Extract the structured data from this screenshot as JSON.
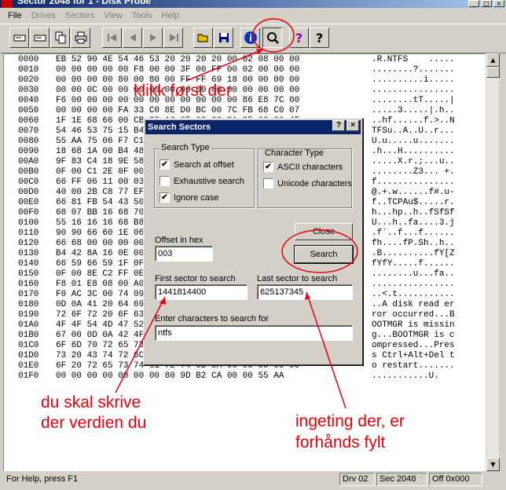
{
  "window": {
    "title": "Sector 2048 for 1 - Disk Probe",
    "minimize": "_",
    "maximize": "□",
    "close": "×"
  },
  "menu": [
    "File",
    "Drives",
    "Sectors",
    "View",
    "Tools",
    "Help"
  ],
  "hex_rows": [
    [
      "0000",
      "EB 52 90 4E 54 46 53 20 20 20 20 00 02 08 00 00",
      ".R.NTFS    ....."
    ],
    [
      "0010",
      "00 00 00 00 00 F8 00 00 3F 00 FF 00 02 00 00 00",
      "........?......."
    ],
    [
      "0020",
      "00 00 00 00 80 00 80 00 FF FF 69 18 00 00 00 00",
      "..........i....."
    ],
    [
      "0030",
      "00 00 0C 00 00 00 00 00 00 00 00 00 00 00 00 00",
      "................"
    ],
    [
      "0040",
      "F6 00 00 00 00 00 00 00 00 00 00 00 86 E8 7C 00",
      "........tT.....|"
    ],
    [
      "0050",
      "00 00 00 00 FA 33 C0 8E D0 BC 00 7C FB 68 C0 07",
      ".....3.....|.h.."
    ],
    [
      "0060",
      "1F 1E 68 66 00 CB 88 16 0E 00 66 81 3E 03 00 4E",
      "..hf......f.>..N"
    ],
    [
      "0070",
      "54 46 53 75 15 B4 41 BB AA 55 CD 13 72 0C 81 FB",
      "TFSu..A..U..r..."
    ],
    [
      "0080",
      "55 AA 75 06 F7 C1 01 00 75 03 E9 DD 00 1E 83 EC",
      "U.u.....u......."
    ],
    [
      "0090",
      "18 68 1A 00 B4 48 8A 16 0E 00 8B F4 16 1F CD 13",
      ".h...H.........."
    ],
    [
      "00A0",
      "9F 83 C4 18 9E 58 1F 72 E1 3B 06 0B 00 75 DB A3",
      ".....X.r.;...u.."
    ],
    [
      "00B0",
      "0F 00 C1 2E 0F 00 04 1E 5A 33 DB B9 00 20 2B C8",
      "........Z3... +."
    ],
    [
      "00C0",
      "66 FF 06 11 00 03 16 0F 00 8E C2 FF 06 16 00 E8",
      "f..............."
    ],
    [
      "00D0",
      "40 00 2B C8 77 EF B8 00 BB CD 1A 66 23 C0 75 2D",
      "@.+.w......f#.u-"
    ],
    [
      "00E0",
      "66 81 FB 54 43 50 41 75 24 81 F9 02 01 72 1E 16",
      "f..TCPAu$.....r."
    ],
    [
      "00F0",
      "68 07 BB 16 68 70 0E 16 68 09 00 66 53 66 53 66",
      "h...hp..h..fSfSf"
    ],
    [
      "0100",
      "55 16 16 16 68 B8 01 66 61 0E 07 CD 1A 33 C0 6A",
      "U...h..fa....3.j"
    ],
    [
      "0110",
      "90 90 66 60 1E 06 66 A1 11 00 66 03 06 1C 00 1E",
      ".f`..f...f......"
    ],
    [
      "0120",
      "66 68 00 00 00 00 66 50 06 53 68 01 00 68 10 00",
      "fh....fP.Sh..h.."
    ],
    [
      "0130",
      "B4 42 8A 16 0E 00 16 1F 8B F4 CD 13 66 59 5B 5A",
      ".B..........fY[Z"
    ],
    [
      "0140",
      "66 59 66 59 1F 0F 82 16 00 66 FF 06 11 00 03 16",
      "fYfY.....f......"
    ],
    [
      "0150",
      "0F 00 8E C2 FF 0E 16 00 75 BC 07 1F 66 61 C3 A0",
      "........u...fa.."
    ],
    [
      "0160",
      "F8 01 E8 08 00 A0 FB 01 E8 02 00 EB FE B4 01 8B",
      "................"
    ],
    [
      "0170",
      "F0 AC 3C 00 74 09 B4 0E BB 07 00 CD 10 EB F2 C3",
      "..<.t..........."
    ],
    [
      "0180",
      "0D 0A 41 20 64 69 73 6B 20 72 65 61 64 20 65 72",
      "..A disk read er"
    ],
    [
      "0190",
      "72 6F 72 20 6F 63 63 75 72 72 65 64 00 0D 0A 42",
      "ror occurred...B"
    ],
    [
      "01A0",
      "4F 4F 54 4D 47 52 20 69 73 20 6D 69 73 73 69 6E",
      "OOTMGR is missin"
    ],
    [
      "01B0",
      "67 00 0D 0A 42 4F 4F 54 4D 47 52 20 69 73 20 63",
      "g...BOOTMGR is c"
    ],
    [
      "01C0",
      "6F 6D 70 72 65 73 73 65 64 00 0D 0A 50 72 65 73",
      "ompressed...Pres"
    ],
    [
      "01D0",
      "73 20 43 74 72 6C 2B 41 6C 74 2B 44 65 6C 20 74",
      "s Ctrl+Alt+Del t"
    ],
    [
      "01E0",
      "6F 20 72 65 73 74 61 72 74 0D 0A 00 00 00 00 00",
      "o restart......."
    ],
    [
      "01F0",
      "00 00 00 00 00 00 00 80 9D B2 CA 00 00 55 AA",
      "...........U."
    ]
  ],
  "status": {
    "help": "For Help, press F1",
    "drive": "Drv  02",
    "sector": "Sec 2048",
    "offset": "Off 0x000"
  },
  "dialog": {
    "title": "Search Sectors",
    "help_btn": "?",
    "close_btn": "×",
    "search_type": {
      "title": "Search Type",
      "options": [
        {
          "label": "Search at offset",
          "checked": "✔"
        },
        {
          "label": "Exhaustive search",
          "checked": ""
        },
        {
          "label": "Ignore case",
          "checked": "✔"
        }
      ]
    },
    "character_type": {
      "title": "Character Type",
      "options": [
        {
          "label": "ASCII characters",
          "checked": "✔"
        },
        {
          "label": "Unicode characters",
          "checked": ""
        }
      ]
    },
    "close_button": "Close",
    "search_button": "Search",
    "offset": {
      "label": "Offset in hex",
      "value": "003"
    },
    "first_sector": {
      "label": "First sector to search",
      "value": "1441814400"
    },
    "last_sector": {
      "label": "Last sector to search",
      "value": "625137345"
    },
    "chars": {
      "label": "Enter characters to search for",
      "value": "ntfs"
    }
  },
  "annotations": {
    "top": "klikk først der",
    "left_line1": "du skal skrive",
    "left_line2": "der verdien du",
    "right_line1": "ingeting der, er",
    "right_line2": "forhånds fylt",
    "color": "#e8000a"
  }
}
